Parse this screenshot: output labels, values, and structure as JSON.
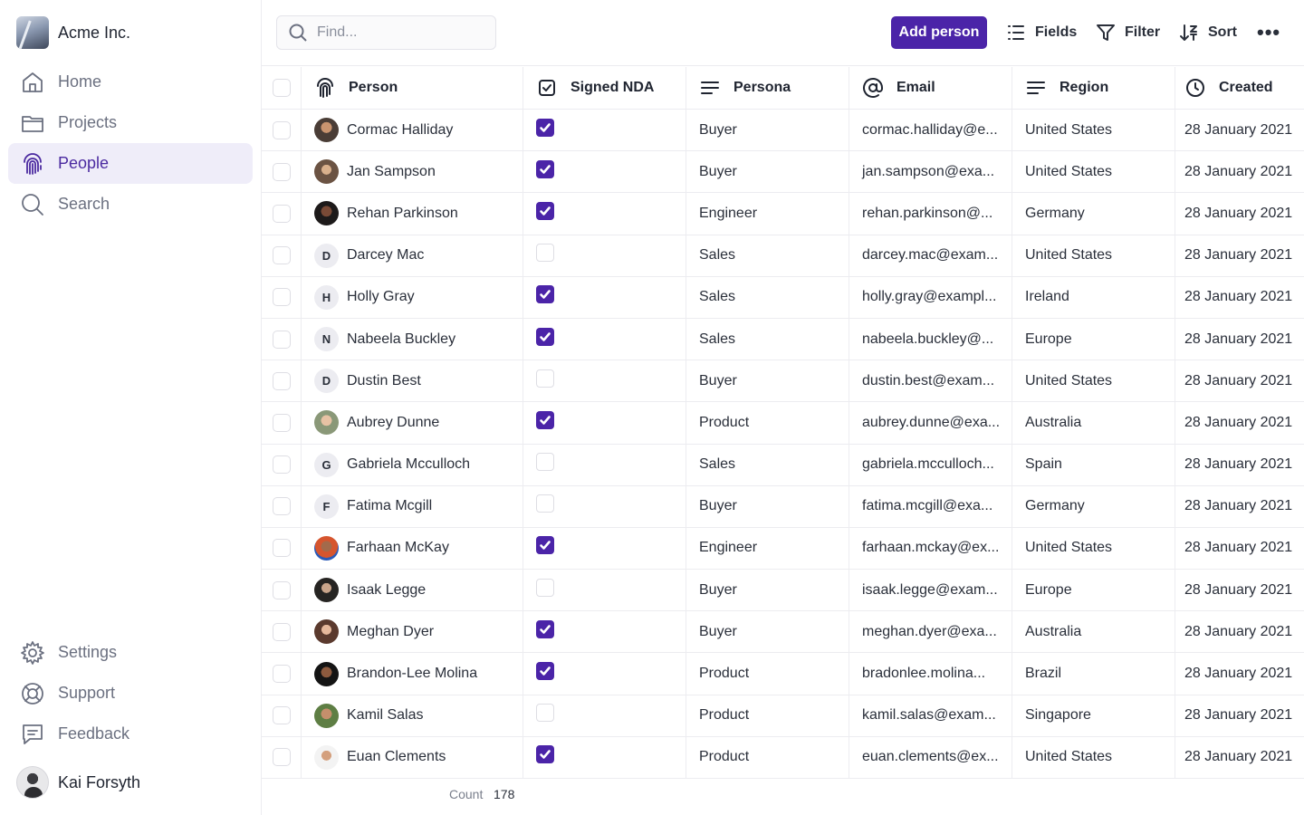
{
  "workspace": {
    "name": "Acme Inc."
  },
  "nav": {
    "top": [
      {
        "label": "Home",
        "icon": "home-icon"
      },
      {
        "label": "Projects",
        "icon": "folder-icon"
      },
      {
        "label": "People",
        "icon": "fingerprint-icon",
        "active": true
      },
      {
        "label": "Search",
        "icon": "search-icon"
      }
    ],
    "bottom": [
      {
        "label": "Settings",
        "icon": "gear-icon"
      },
      {
        "label": "Support",
        "icon": "lifebuoy-icon"
      },
      {
        "label": "Feedback",
        "icon": "message-icon"
      }
    ]
  },
  "user": {
    "name": "Kai Forsyth"
  },
  "toolbar": {
    "search_placeholder": "Find...",
    "add_label": "Add person",
    "fields_label": "Fields",
    "filter_label": "Filter",
    "sort_label": "Sort",
    "more_label": "•••"
  },
  "colors": {
    "accent": "#4b24a8",
    "active_bg": "#efedf9"
  },
  "table": {
    "columns": [
      "Person",
      "Signed NDA",
      "Persona",
      "Email",
      "Region",
      "Created"
    ],
    "rows": [
      {
        "name": "Cormac Halliday",
        "avatar": "photo",
        "nda": true,
        "persona": "Buyer",
        "email": "cormac.halliday@e...",
        "region": "United States",
        "created": "28 January 2021"
      },
      {
        "name": "Jan Sampson",
        "avatar": "p2",
        "nda": true,
        "persona": "Buyer",
        "email": "jan.sampson@exa...",
        "region": "United States",
        "created": "28 January 2021"
      },
      {
        "name": "Rehan Parkinson",
        "avatar": "p3",
        "nda": true,
        "persona": "Engineer",
        "email": "rehan.parkinson@...",
        "region": "Germany",
        "created": "28 January 2021"
      },
      {
        "name": "Darcey Mac",
        "avatar": "initial",
        "initial": "D",
        "nda": false,
        "persona": "Sales",
        "email": "darcey.mac@exam...",
        "region": "United States",
        "created": "28 January 2021"
      },
      {
        "name": "Holly Gray",
        "avatar": "initial",
        "initial": "H",
        "nda": true,
        "persona": "Sales",
        "email": "holly.gray@exampl...",
        "region": "Ireland",
        "created": "28 January 2021"
      },
      {
        "name": "Nabeela Buckley",
        "avatar": "initial",
        "initial": "N",
        "nda": true,
        "persona": "Sales",
        "email": "nabeela.buckley@...",
        "region": "Europe",
        "created": "28 January 2021"
      },
      {
        "name": "Dustin Best",
        "avatar": "initial",
        "initial": "D",
        "nda": false,
        "persona": "Buyer",
        "email": "dustin.best@exam...",
        "region": "United States",
        "created": "28 January 2021"
      },
      {
        "name": "Aubrey Dunne",
        "avatar": "p4",
        "nda": true,
        "persona": "Product",
        "email": "aubrey.dunne@exa...",
        "region": "Australia",
        "created": "28 January 2021"
      },
      {
        "name": "Gabriela Mcculloch",
        "avatar": "initial",
        "initial": "G",
        "nda": false,
        "persona": "Sales",
        "email": "gabriela.mcculloch...",
        "region": "Spain",
        "created": "28 January 2021"
      },
      {
        "name": "Fatima Mcgill",
        "avatar": "initial",
        "initial": "F",
        "nda": false,
        "persona": "Buyer",
        "email": "fatima.mcgill@exa...",
        "region": "Germany",
        "created": "28 January 2021"
      },
      {
        "name": "Farhaan McKay",
        "avatar": "p5",
        "nda": true,
        "persona": "Engineer",
        "email": "farhaan.mckay@ex...",
        "region": "United States",
        "created": "28 January 2021"
      },
      {
        "name": "Isaak Legge",
        "avatar": "p6",
        "nda": false,
        "persona": "Buyer",
        "email": "isaak.legge@exam...",
        "region": "Europe",
        "created": "28 January 2021"
      },
      {
        "name": "Meghan Dyer",
        "avatar": "p7",
        "nda": true,
        "persona": "Buyer",
        "email": "meghan.dyer@exa...",
        "region": "Australia",
        "created": "28 January 2021"
      },
      {
        "name": "Brandon-Lee Molina",
        "avatar": "p8",
        "nda": true,
        "persona": "Product",
        "email": "bradonlee.molina...",
        "region": "Brazil",
        "created": "28 January 2021"
      },
      {
        "name": "Kamil Salas",
        "avatar": "p9",
        "nda": false,
        "persona": "Product",
        "email": "kamil.salas@exam...",
        "region": "Singapore",
        "created": "28 January 2021"
      },
      {
        "name": "Euan Clements",
        "avatar": "p10",
        "nda": true,
        "persona": "Product",
        "email": "euan.clements@ex...",
        "region": "United States",
        "created": "28 January 2021"
      }
    ]
  },
  "footer": {
    "count_label": "Count",
    "count_value": "178"
  }
}
